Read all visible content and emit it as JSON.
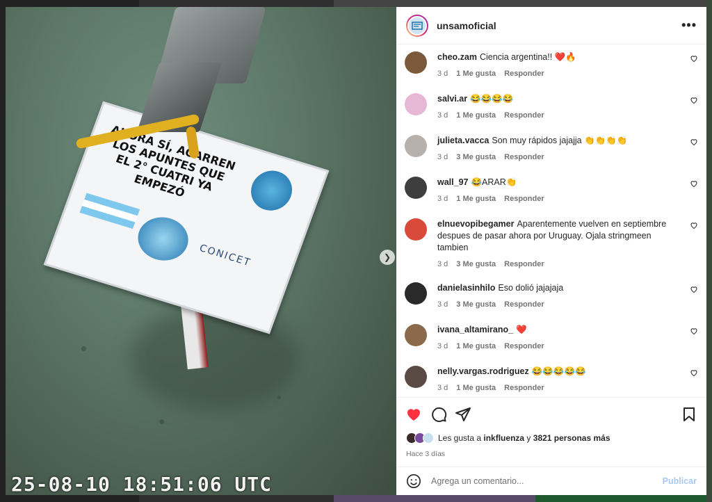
{
  "post": {
    "username": "unsamoficial",
    "more_label": "•••",
    "sign_text": "AHORA SÍ, AGARREN LOS APUNTES QUE EL 2° CUATRI YA EMPEZÓ",
    "sign_org": "CONICET",
    "video_timestamp": "25-08-10 18:51:06 UTC"
  },
  "comments": [
    {
      "user": "cheo.zam",
      "text": "Ciencia argentina!! ❤️🔥",
      "age": "3 d",
      "likes": "1 Me gusta",
      "reply": "Responder",
      "avatar_color": "#7a5a3a"
    },
    {
      "user": "salvi.ar",
      "text": "😂😂😂😂",
      "age": "3 d",
      "likes": "1 Me gusta",
      "reply": "Responder",
      "avatar_color": "#e7b7d6"
    },
    {
      "user": "julieta.vacca",
      "text": "Son muy rápidos jajajja 👏👏👏👏",
      "age": "3 d",
      "likes": "3 Me gusta",
      "reply": "Responder",
      "avatar_color": "#b8b0aa"
    },
    {
      "user": "wall_97",
      "text": "😂ARAR👏",
      "age": "3 d",
      "likes": "1 Me gusta",
      "reply": "Responder",
      "avatar_color": "#3e3e3e"
    },
    {
      "user": "elnuevopibegamer",
      "text": "Aparentemente vuelven en septiembre despues de pasar ahora por Uruguay. Ojala stringmeen tambien",
      "age": "3 d",
      "likes": "3 Me gusta",
      "reply": "Responder",
      "avatar_color": "#d94a3a"
    },
    {
      "user": "danielasinhilo",
      "text": "Eso dolió jajajaja",
      "age": "3 d",
      "likes": "3 Me gusta",
      "reply": "Responder",
      "avatar_color": "#2a2a2a"
    },
    {
      "user": "ivana_altamirano_",
      "text": "❤️",
      "age": "3 d",
      "likes": "1 Me gusta",
      "reply": "Responder",
      "avatar_color": "#8a6a4a"
    },
    {
      "user": "nelly.vargas.rodriguez",
      "text": "😂😂😂😂😂",
      "age": "3 d",
      "likes": "1 Me gusta",
      "reply": "Responder",
      "avatar_color": "#5a4a44"
    }
  ],
  "likes_summary": {
    "prefix": "Les gusta a",
    "user": "inkfluenza",
    "connector": "y",
    "others": "3821 personas más"
  },
  "post_age": "Hace 3 días",
  "add_comment": {
    "placeholder": "Agrega un comentario...",
    "publish_label": "Publicar"
  },
  "colors": {
    "liked_heart": "#ff3040",
    "publish_disabled": "#a7c8f2",
    "meta_gray": "#737373"
  }
}
